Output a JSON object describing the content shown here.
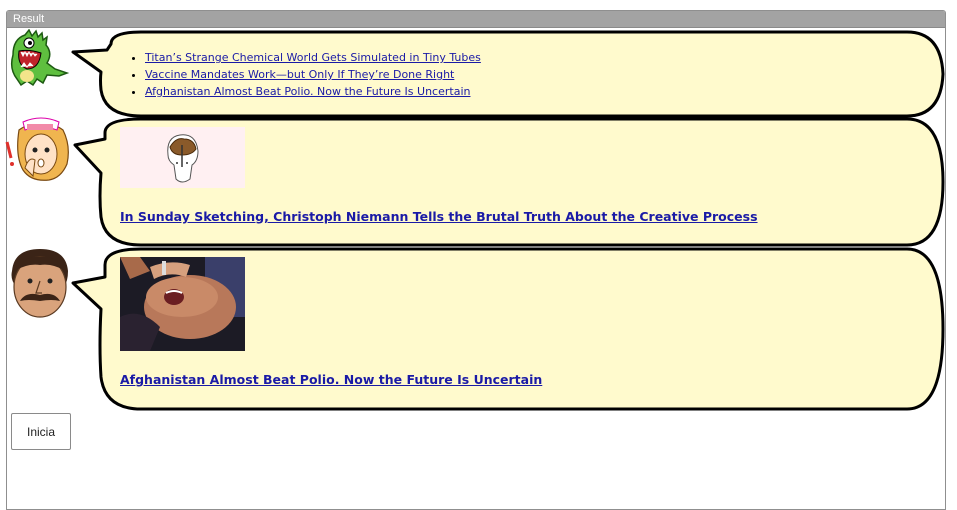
{
  "panel": {
    "title": "Result"
  },
  "messages": [
    {
      "avatar": "dinosaur-avatar",
      "links": [
        "Titan’s Strange Chemical World Gets Simulated in Tiny Tubes",
        "Vaccine Mandates Work—but Only If They’re Done Right",
        "Afghanistan Almost Beat Polio. Now the Future Is Uncertain"
      ]
    },
    {
      "avatar": "nurse-avatar",
      "image": "brain-sketch-image",
      "headline": "In Sunday Sketching, Christoph Niemann Tells the Brutal Truth About the Creative Process"
    },
    {
      "avatar": "mustache-man-avatar",
      "image": "polio-vaccination-photo",
      "headline": "Afghanistan Almost Beat Polio. Now the Future Is Uncertain"
    }
  ],
  "controls": {
    "start_label": "Inicia"
  },
  "colors": {
    "bubble_fill": "#fffacd",
    "bubble_stroke": "#000000",
    "link": "#1a1aa6",
    "header": "#a3a3a3"
  }
}
